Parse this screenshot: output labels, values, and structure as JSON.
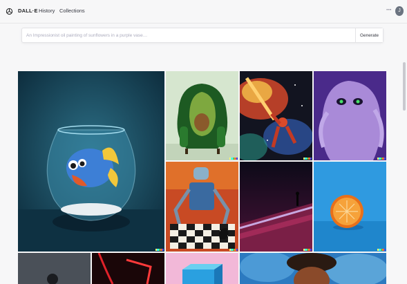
{
  "header": {
    "brand": "DALL·E",
    "nav": {
      "history": "History",
      "collections": "Collections"
    },
    "more_label": "···",
    "avatar_initial": "J"
  },
  "prompt": {
    "placeholder": "An Impressionist oil painting of sunflowers in a purple vase…",
    "value": "",
    "generate_label": "Generate"
  },
  "gallery": {
    "images": [
      {
        "subject": "fish-in-bowl"
      },
      {
        "subject": "avocado-armchair"
      },
      {
        "subject": "astronaut-space-nebula"
      },
      {
        "subject": "purple-furry-monster"
      },
      {
        "subject": "robot-playing-chess"
      },
      {
        "subject": "figure-on-dune"
      },
      {
        "subject": "orange-half"
      },
      {
        "subject": "dark-figure"
      },
      {
        "subject": "red-neon"
      },
      {
        "subject": "blue-box"
      },
      {
        "subject": "portrait-splash"
      }
    ]
  },
  "colors": {
    "accent": "#10a37f",
    "signature": [
      "#ffff66",
      "#42ffff",
      "#51da4c",
      "#ff6e3c",
      "#3c46ff"
    ]
  }
}
